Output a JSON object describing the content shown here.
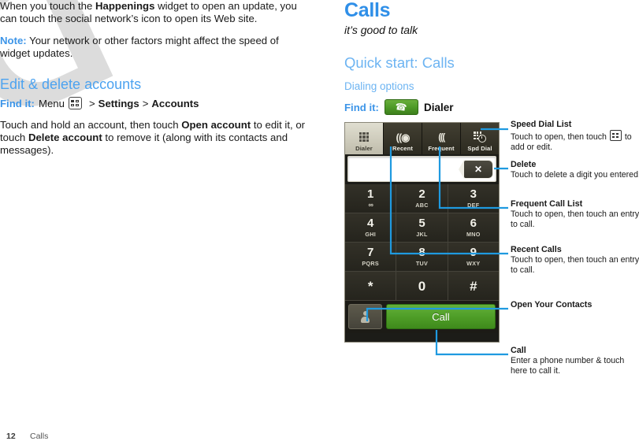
{
  "left_column": {
    "paragraphs": [
      {
        "id": "p-happenings",
        "runs": [
          {
            "t": "When you touch the ",
            "b": false
          },
          {
            "t": "Happenings",
            "b": true
          },
          {
            "t": " widget to open an update, you can touch the social network’s icon to open its Web site.",
            "b": false
          }
        ]
      }
    ],
    "note": {
      "label": "Note:",
      "text": " Your network or other factors might affect the speed of widget updates."
    },
    "section_heading": "Edit & delete accounts",
    "find_it": {
      "label": "Find it:",
      "first": "Menu",
      "icon": "menu-key-icon",
      "separator": ">",
      "item1": "Settings",
      "item2": "Accounts"
    },
    "body_paragraph": {
      "runs": [
        {
          "t": "Touch and hold an account, then touch ",
          "b": false
        },
        {
          "t": "Open account",
          "b": true
        },
        {
          "t": " to edit it, or touch ",
          "b": false
        },
        {
          "t": "Delete account",
          "b": true
        },
        {
          "t": " to remove it (along with its contacts and messages).",
          "b": false
        }
      ]
    }
  },
  "right_column": {
    "chapter_title": "Calls",
    "tagline": "it’s good to talk",
    "quick_start": "Quick start: Calls",
    "subhead": "Dialing options",
    "find_it": {
      "label": "Find it:",
      "icon": "phone-handset-icon",
      "app": "Dialer"
    }
  },
  "phone": {
    "tabs": [
      {
        "label": "Dialer",
        "icon": "keypad-grid-icon",
        "selected": true
      },
      {
        "label": "Recent",
        "icon": "recent-calls-icon",
        "selected": false
      },
      {
        "label": "Frequent",
        "icon": "frequent-calls-icon",
        "selected": false
      },
      {
        "label": "Spd Dial",
        "icon": "speed-dial-icon",
        "selected": false
      }
    ],
    "number_field": {
      "value": "",
      "placeholder": ""
    },
    "delete_key": {
      "icon": "backspace-x-icon",
      "glyph": "✕"
    },
    "keypad": [
      [
        {
          "num": "1",
          "sub": "∞",
          "sub_kind": "voicemail"
        },
        {
          "num": "2",
          "sub": "ABC"
        },
        {
          "num": "3",
          "sub": "DEF"
        }
      ],
      [
        {
          "num": "4",
          "sub": "GHI"
        },
        {
          "num": "5",
          "sub": "JKL"
        },
        {
          "num": "6",
          "sub": "MNO"
        }
      ],
      [
        {
          "num": "7",
          "sub": "PQRS"
        },
        {
          "num": "8",
          "sub": "TUV"
        },
        {
          "num": "9",
          "sub": "WXY"
        }
      ],
      [
        {
          "num": "*",
          "sub": ""
        },
        {
          "num": "0",
          "sub": ""
        },
        {
          "num": "#",
          "sub": ""
        }
      ]
    ],
    "contacts_button": {
      "icon": "person-contacts-icon",
      "label": ""
    },
    "call_button": {
      "label": "Call"
    }
  },
  "callouts": [
    {
      "id": "speed-dial-list",
      "title": "Speed Dial List",
      "body_before": "Touch to open, then touch ",
      "inline_icon": "menu-key-icon",
      "body_after": " to add or edit."
    },
    {
      "id": "delete",
      "title": "Delete",
      "body": "Touch to delete a digit you entered."
    },
    {
      "id": "frequent-call-list",
      "title": "Frequent Call List",
      "body": "Touch to open, then touch an entry to call."
    },
    {
      "id": "recent-calls",
      "title": "Recent Calls",
      "body": "Touch to open, then touch an entry to call."
    },
    {
      "id": "open-your-contacts",
      "title": "Open Your Contacts",
      "body": ""
    },
    {
      "id": "call",
      "title": "Call",
      "body": "Enter a phone number & touch here to call it."
    }
  ],
  "footer": {
    "page_number": "12",
    "chapter": "Calls"
  },
  "watermark": {
    "text": "DRAFT"
  },
  "colors": {
    "accent_blue": "#3d95e8",
    "heading_blue": "#4da3f0",
    "light_blue": "#6db4f2",
    "chapter_blue": "#2f8fe8",
    "callout_line": "#1f9ae0",
    "call_green": "#4d9c26",
    "watermark_gray": "#dcdcdc"
  }
}
